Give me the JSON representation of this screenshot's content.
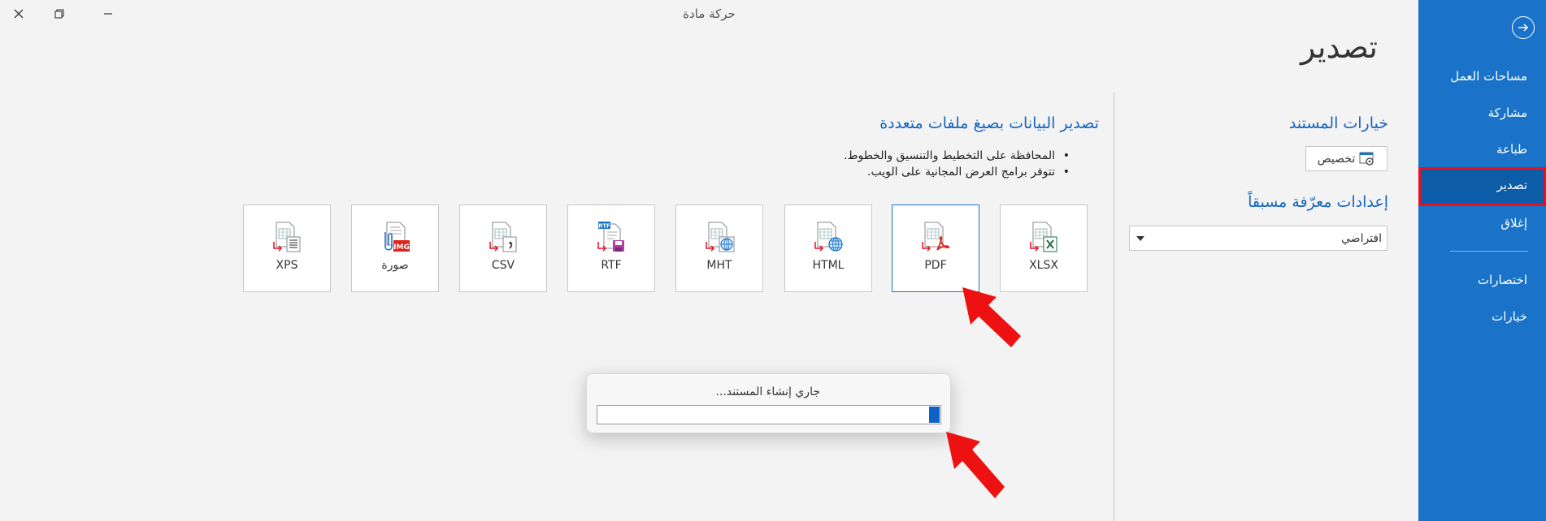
{
  "window": {
    "title": "حركة مادة"
  },
  "sidebar": {
    "items": [
      {
        "label": "مساحات العمل"
      },
      {
        "label": "مشاركة"
      },
      {
        "label": "طباعة"
      },
      {
        "label": "تصدير"
      },
      {
        "label": "إغلاق"
      },
      {
        "label": "اختصارات"
      },
      {
        "label": "خيارات"
      }
    ],
    "active_item": "تصدير"
  },
  "page": {
    "title": "تصدير"
  },
  "document_options": {
    "title": "خيارات المستند",
    "customize_label": "تخصيص"
  },
  "presets": {
    "title": "إعدادات معرّفة مسبقاً",
    "selected": "افتراضي"
  },
  "export": {
    "title": "تصدير البيانات بصيغ ملفات متعددة",
    "bullets": [
      "المحافظة على التخطيط والتنسيق والخطوط.",
      "تتوفر برامج العرض المجانية على الويب."
    ],
    "formats": [
      {
        "label": "XLSX",
        "icon": "xlsx-file-icon"
      },
      {
        "label": "PDF",
        "icon": "pdf-file-icon"
      },
      {
        "label": "HTML",
        "icon": "html-file-icon"
      },
      {
        "label": "MHT",
        "icon": "mht-file-icon"
      },
      {
        "label": "RTF",
        "icon": "rtf-file-icon"
      },
      {
        "label": "CSV",
        "icon": "csv-file-icon"
      },
      {
        "label": "صورة",
        "icon": "image-file-icon"
      },
      {
        "label": "XPS",
        "icon": "xps-file-icon"
      }
    ],
    "selected_format": "PDF"
  },
  "progress_dialog": {
    "message": "جاري إنشاء المستند...",
    "progress": 0.03
  },
  "colors": {
    "sidebar": "#1a73c8",
    "accent": "#1565c0",
    "highlight": "#e81123",
    "progress": "#0b63c5"
  }
}
